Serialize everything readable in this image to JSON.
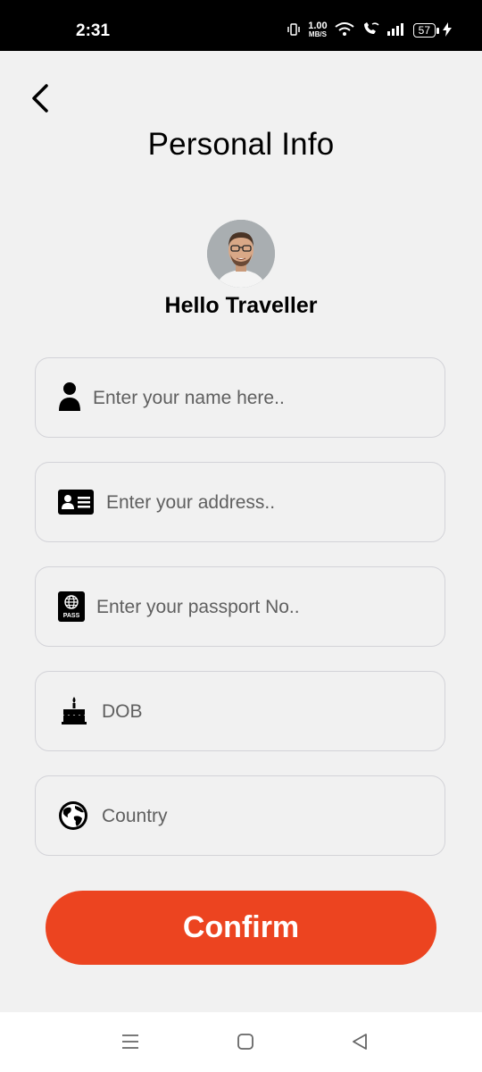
{
  "status_bar": {
    "time": "2:31",
    "net_speed_value": "1.00",
    "net_speed_unit": "MB/S",
    "battery": "57"
  },
  "header": {
    "title": "Personal Info"
  },
  "profile": {
    "greeting": "Hello Traveller"
  },
  "form": {
    "name_placeholder": "Enter your name here..",
    "address_placeholder": "Enter your address..",
    "passport_placeholder": "Enter your passport No..",
    "passport_icon_text": "PASS",
    "dob_placeholder": "DOB",
    "country_placeholder": "Country"
  },
  "actions": {
    "confirm_label": "Confirm"
  },
  "colors": {
    "accent": "#ec4420",
    "background": "#f1f1f1"
  }
}
